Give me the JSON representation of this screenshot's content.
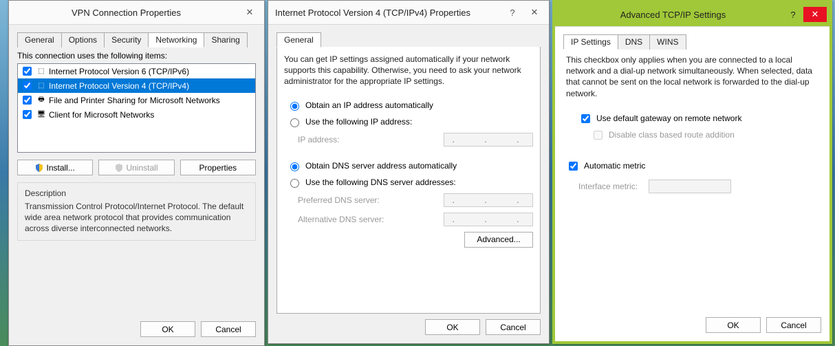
{
  "dialog1": {
    "title": "VPN Connection Properties",
    "tabs": [
      "General",
      "Options",
      "Security",
      "Networking",
      "Sharing"
    ],
    "active_tab": 3,
    "uses_label": "This connection uses the following items:",
    "items": [
      {
        "label": "Internet Protocol Version 6 (TCP/IPv6)",
        "checked": true,
        "selected": false,
        "icon": "network-protocol-icon"
      },
      {
        "label": "Internet Protocol Version 4 (TCP/IPv4)",
        "checked": true,
        "selected": true,
        "icon": "network-protocol-icon"
      },
      {
        "label": "File and Printer Sharing for Microsoft Networks",
        "checked": true,
        "selected": false,
        "icon": "service-icon"
      },
      {
        "label": "Client for Microsoft Networks",
        "checked": true,
        "selected": false,
        "icon": "client-icon"
      }
    ],
    "install_btn": "Install...",
    "uninstall_btn": "Uninstall",
    "properties_btn": "Properties",
    "desc_label": "Description",
    "desc_text": "Transmission Control Protocol/Internet Protocol. The default wide area network protocol that provides communication across diverse interconnected networks.",
    "ok": "OK",
    "cancel": "Cancel"
  },
  "dialog2": {
    "title": "Internet Protocol Version 4 (TCP/IPv4) Properties",
    "tab": "General",
    "intro": "You can get IP settings assigned automatically if your network supports this capability. Otherwise, you need to ask your network administrator for the appropriate IP settings.",
    "radio_ip_auto": "Obtain an IP address automatically",
    "radio_ip_manual": "Use the following IP address:",
    "ip_label": "IP address:",
    "radio_dns_auto": "Obtain DNS server address automatically",
    "radio_dns_manual": "Use the following DNS server addresses:",
    "pref_dns": "Preferred DNS server:",
    "alt_dns": "Alternative DNS server:",
    "ip_placeholder": ".   .   .",
    "advanced_btn": "Advanced...",
    "ok": "OK",
    "cancel": "Cancel"
  },
  "dialog3": {
    "title": "Advanced TCP/IP Settings",
    "tabs": [
      "IP Settings",
      "DNS",
      "WINS"
    ],
    "active_tab": 0,
    "intro": "This checkbox only applies when you are connected to a local network and a dial-up network simultaneously. When selected, data that cannot be sent on the local network is forwarded to the dial-up network.",
    "chk_gateway": "Use default gateway on remote network",
    "chk_classroute": "Disable class based route addition",
    "chk_autometric": "Automatic metric",
    "metric_label": "Interface metric:",
    "ok": "OK",
    "cancel": "Cancel"
  }
}
